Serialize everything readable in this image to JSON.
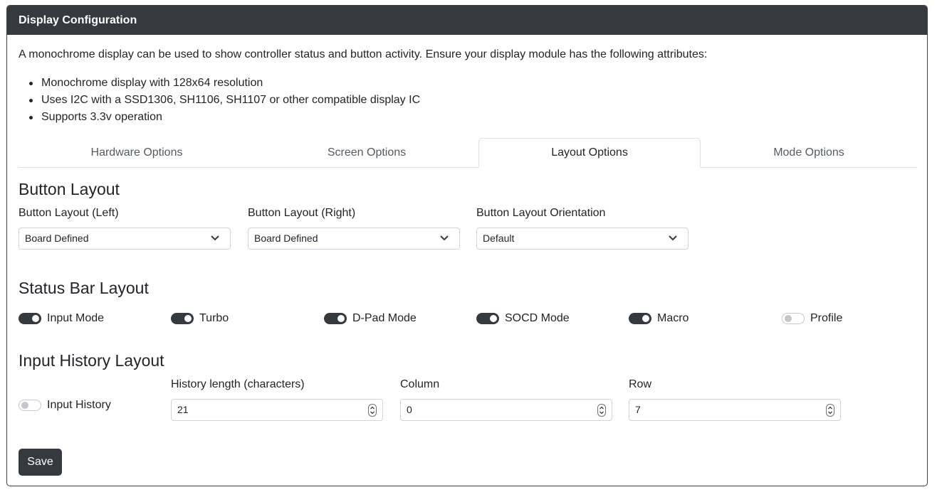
{
  "header": {
    "title": "Display Configuration"
  },
  "intro": "A monochrome display can be used to show controller status and button activity. Ensure your display module has the following attributes:",
  "requirements": [
    "Monochrome display with 128x64 resolution",
    "Uses I2C with a SSD1306, SH1106, SH1107 or other compatible display IC",
    "Supports 3.3v operation"
  ],
  "tabs": [
    {
      "label": "Hardware Options",
      "active": false
    },
    {
      "label": "Screen Options",
      "active": false
    },
    {
      "label": "Layout Options",
      "active": true
    },
    {
      "label": "Mode Options",
      "active": false
    }
  ],
  "button_layout": {
    "title": "Button Layout",
    "left": {
      "label": "Button Layout (Left)",
      "value": "Board Defined"
    },
    "right": {
      "label": "Button Layout (Right)",
      "value": "Board Defined"
    },
    "orientation": {
      "label": "Button Layout Orientation",
      "value": "Default"
    }
  },
  "status_bar": {
    "title": "Status Bar Layout",
    "toggles": [
      {
        "label": "Input Mode",
        "on": true
      },
      {
        "label": "Turbo",
        "on": true
      },
      {
        "label": "D-Pad Mode",
        "on": true
      },
      {
        "label": "SOCD Mode",
        "on": true
      },
      {
        "label": "Macro",
        "on": true
      },
      {
        "label": "Profile",
        "on": false
      }
    ]
  },
  "input_history": {
    "title": "Input History Layout",
    "toggle": {
      "label": "Input History",
      "on": false
    },
    "length": {
      "label": "History length (characters)",
      "value": "21"
    },
    "column": {
      "label": "Column",
      "value": "0"
    },
    "row": {
      "label": "Row",
      "value": "7"
    }
  },
  "save_label": "Save",
  "colors": {
    "header_bg": "#353a40",
    "toggle_on": "#353a40",
    "button_bg": "#353a40"
  },
  "icons": [
    "chevron-down-icon",
    "spinner-arrows-icon"
  ]
}
